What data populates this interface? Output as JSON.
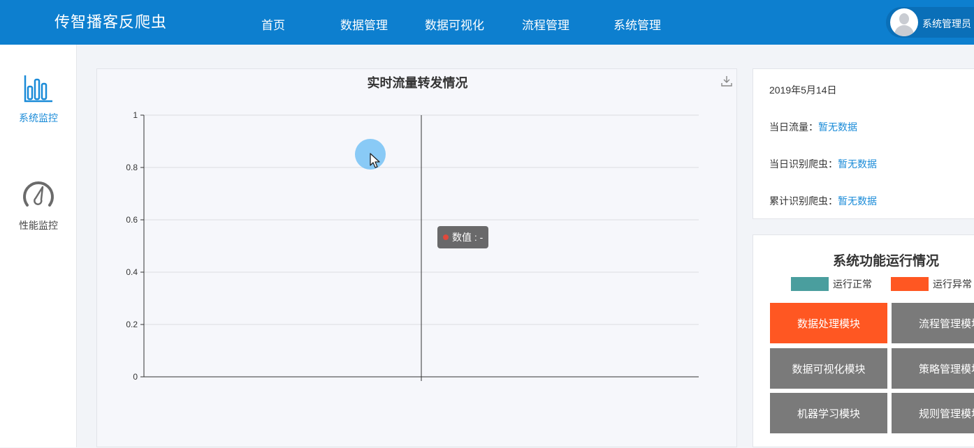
{
  "header": {
    "brand": "传智播客反爬虫",
    "nav": [
      "首页",
      "数据管理",
      "数据可视化",
      "流程管理",
      "系统管理"
    ],
    "user_name": "系统管理员"
  },
  "sidebar": {
    "items": [
      {
        "label": "系统监控",
        "icon": "bar-chart-icon",
        "active": true
      },
      {
        "label": "性能监控",
        "icon": "gauge-icon",
        "active": false
      }
    ]
  },
  "chart_panel": {
    "download_icon": "download-icon",
    "tooltip": "数值 : -"
  },
  "chart_data": {
    "type": "line",
    "title": "实时流量转发情况",
    "xlabel": "",
    "ylabel": "",
    "ylim": [
      0,
      1
    ],
    "yticks": [
      "0",
      "0.2",
      "0.4",
      "0.6",
      "0.8",
      "1"
    ],
    "series": [
      {
        "values": []
      }
    ],
    "grid": true
  },
  "info": {
    "date": "2019年5月14日",
    "rows": [
      {
        "label": "当日流量：",
        "value": "暂无数据"
      },
      {
        "label": "当日识别爬虫：",
        "value": "暂无数据"
      },
      {
        "label": "累计识别爬虫：",
        "value": "暂无数据"
      }
    ]
  },
  "functions": {
    "title": "系统功能运行情况",
    "legend": [
      {
        "label": "运行正常",
        "color": "#4a9e9e"
      },
      {
        "label": "运行异常",
        "color": "#ff5722"
      }
    ],
    "modules": [
      {
        "label": "数据处理模块",
        "status": "error"
      },
      {
        "label": "流程管理模块",
        "status": "normal"
      },
      {
        "label": "数据可视化模块",
        "status": "normal"
      },
      {
        "label": "策略管理模块",
        "status": "normal"
      },
      {
        "label": "机器学习模块",
        "status": "normal"
      },
      {
        "label": "规则管理模块",
        "status": "normal"
      }
    ],
    "colors": {
      "error": "#ff5722",
      "normal": "#7a7a7a"
    }
  }
}
